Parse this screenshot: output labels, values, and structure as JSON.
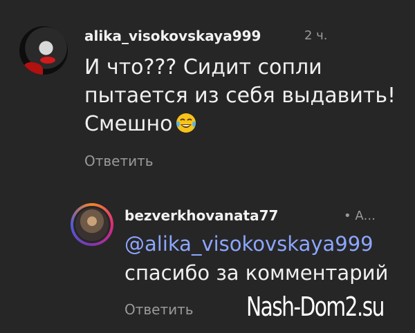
{
  "comments": [
    {
      "username": "alika_visokovskaya999",
      "time": "2 ч.",
      "text": "И что??? Сидит сопли пытается из себя выдавить! Смешно",
      "emoji": "face-with-tears-of-joy-icon",
      "reply_label": "Ответить"
    },
    {
      "username": "bezverkhovanata77",
      "time": "• А...",
      "mention": "@alika_visokovskaya999",
      "text": "спасибо за комментарий",
      "reply_label": "Ответить"
    }
  ],
  "watermark": "Nash-Dom2.su",
  "colors": {
    "background": "#262626",
    "text": "#f2f2f2",
    "muted": "#9a9a9a",
    "mention": "#8da6ff"
  }
}
